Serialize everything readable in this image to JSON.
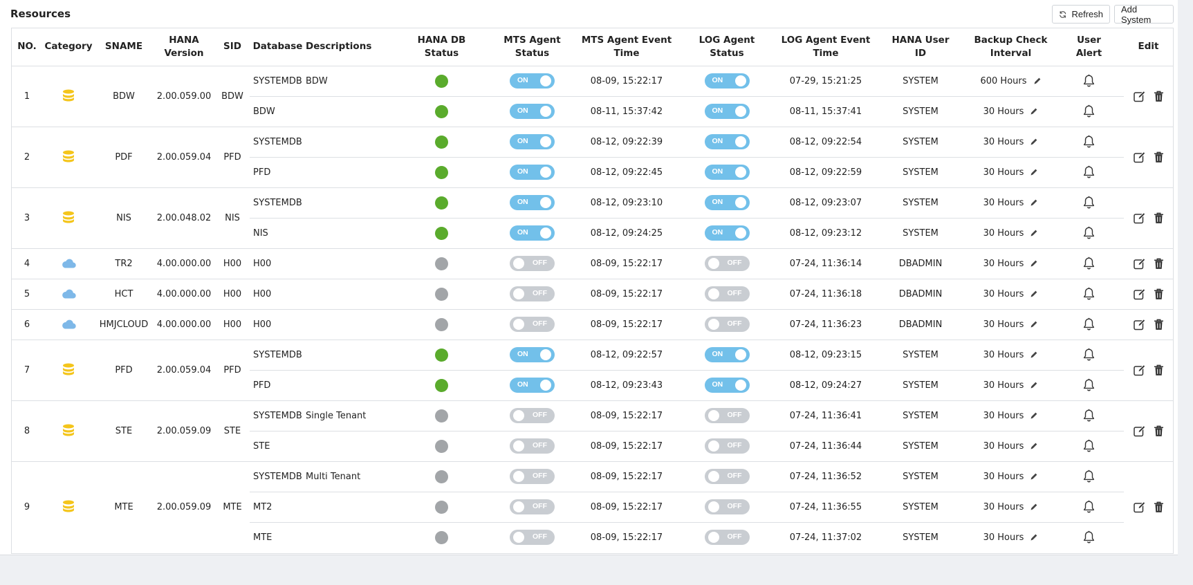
{
  "page": {
    "title": "Resources"
  },
  "toolbar": {
    "refresh_label": "Refresh",
    "add_label": "Add System"
  },
  "columns": {
    "no": "NO.",
    "category": "Category",
    "sname": "SNAME",
    "hana_version_1": "HANA",
    "hana_version_2": "Version",
    "sid": "SID",
    "database": "Database",
    "descriptions": "Descriptions",
    "db_status_1": "HANA DB",
    "db_status_2": "Status",
    "mts_status_1": "MTS Agent",
    "mts_status_2": "Status",
    "mts_time_1": "MTS Agent Event",
    "mts_time_2": "Time",
    "log_status_1": "LOG Agent",
    "log_status_2": "Status",
    "log_time_1": "LOG Agent Event",
    "log_time_2": "Time",
    "user_1": "HANA User",
    "user_2": "ID",
    "backup_1": "Backup Check",
    "backup_2": "Interval",
    "alert_1": "User",
    "alert_2": "Alert",
    "edit": "Edit"
  },
  "toggle_labels": {
    "on": "ON",
    "off": "OFF"
  },
  "colors": {
    "status_on": "#5aab2c",
    "status_off": "#a2a5a8",
    "toggle_on": "#72c0ea",
    "toggle_off": "#c9cdd2",
    "db_icon": "#f4c51b",
    "cloud_icon": "#7eb8e8"
  },
  "systems": [
    {
      "no": "1",
      "category": "database-icon",
      "sname": "BDW",
      "version": "2.00.059.00",
      "sid": "BDW",
      "dbs": [
        {
          "database": "SYSTEMDB",
          "description": "BDW",
          "db_status": "on",
          "mts": "on",
          "mts_time": "08-09, 15:22:17",
          "log": "on",
          "log_time": "07-29, 15:21:25",
          "user": "SYSTEM",
          "interval": "600 Hours"
        },
        {
          "database": "BDW",
          "description": "",
          "db_status": "on",
          "mts": "on",
          "mts_time": "08-11, 15:37:42",
          "log": "on",
          "log_time": "08-11, 15:37:41",
          "user": "SYSTEM",
          "interval": "30 Hours"
        }
      ]
    },
    {
      "no": "2",
      "category": "database-icon",
      "sname": "PDF",
      "version": "2.00.059.04",
      "sid": "PFD",
      "dbs": [
        {
          "database": "SYSTEMDB",
          "description": "",
          "db_status": "on",
          "mts": "on",
          "mts_time": "08-12, 09:22:39",
          "log": "on",
          "log_time": "08-12, 09:22:54",
          "user": "SYSTEM",
          "interval": "30 Hours"
        },
        {
          "database": "PFD",
          "description": "",
          "db_status": "on",
          "mts": "on",
          "mts_time": "08-12, 09:22:45",
          "log": "on",
          "log_time": "08-12, 09:22:59",
          "user": "SYSTEM",
          "interval": "30 Hours"
        }
      ]
    },
    {
      "no": "3",
      "category": "database-icon",
      "sname": "NIS",
      "version": "2.00.048.02",
      "sid": "NIS",
      "dbs": [
        {
          "database": "SYSTEMDB",
          "description": "",
          "db_status": "on",
          "mts": "on",
          "mts_time": "08-12, 09:23:10",
          "log": "on",
          "log_time": "08-12, 09:23:07",
          "user": "SYSTEM",
          "interval": "30 Hours"
        },
        {
          "database": "NIS",
          "description": "",
          "db_status": "on",
          "mts": "on",
          "mts_time": "08-12, 09:24:25",
          "log": "on",
          "log_time": "08-12, 09:23:12",
          "user": "SYSTEM",
          "interval": "30 Hours"
        }
      ]
    },
    {
      "no": "4",
      "category": "cloud-icon",
      "sname": "TR2",
      "version": "4.00.000.00",
      "sid": "H00",
      "dbs": [
        {
          "database": "H00",
          "description": "",
          "db_status": "off",
          "mts": "off",
          "mts_time": "08-09, 15:22:17",
          "log": "off",
          "log_time": "07-24, 11:36:14",
          "user": "DBADMIN",
          "interval": "30 Hours"
        }
      ]
    },
    {
      "no": "5",
      "category": "cloud-icon",
      "sname": "HCT",
      "version": "4.00.000.00",
      "sid": "H00",
      "dbs": [
        {
          "database": "H00",
          "description": "",
          "db_status": "off",
          "mts": "off",
          "mts_time": "08-09, 15:22:17",
          "log": "off",
          "log_time": "07-24, 11:36:18",
          "user": "DBADMIN",
          "interval": "30 Hours"
        }
      ]
    },
    {
      "no": "6",
      "category": "cloud-icon",
      "sname": "HMJCLOUD",
      "version": "4.00.000.00",
      "sid": "H00",
      "dbs": [
        {
          "database": "H00",
          "description": "",
          "db_status": "off",
          "mts": "off",
          "mts_time": "08-09, 15:22:17",
          "log": "off",
          "log_time": "07-24, 11:36:23",
          "user": "DBADMIN",
          "interval": "30 Hours"
        }
      ]
    },
    {
      "no": "7",
      "category": "database-icon",
      "sname": "PFD",
      "version": "2.00.059.04",
      "sid": "PFD",
      "dbs": [
        {
          "database": "SYSTEMDB",
          "description": "",
          "db_status": "on",
          "mts": "on",
          "mts_time": "08-12, 09:22:57",
          "log": "on",
          "log_time": "08-12, 09:23:15",
          "user": "SYSTEM",
          "interval": "30 Hours"
        },
        {
          "database": "PFD",
          "description": "",
          "db_status": "on",
          "mts": "on",
          "mts_time": "08-12, 09:23:43",
          "log": "on",
          "log_time": "08-12, 09:24:27",
          "user": "SYSTEM",
          "interval": "30 Hours"
        }
      ]
    },
    {
      "no": "8",
      "category": "database-icon",
      "sname": "STE",
      "version": "2.00.059.09",
      "sid": "STE",
      "dbs": [
        {
          "database": "SYSTEMDB",
          "description": "Single Tenant",
          "db_status": "off",
          "mts": "off",
          "mts_time": "08-09, 15:22:17",
          "log": "off",
          "log_time": "07-24, 11:36:41",
          "user": "SYSTEM",
          "interval": "30 Hours"
        },
        {
          "database": "STE",
          "description": "",
          "db_status": "off",
          "mts": "off",
          "mts_time": "08-09, 15:22:17",
          "log": "off",
          "log_time": "07-24, 11:36:44",
          "user": "SYSTEM",
          "interval": "30 Hours"
        }
      ]
    },
    {
      "no": "9",
      "category": "database-icon",
      "sname": "MTE",
      "version": "2.00.059.09",
      "sid": "MTE",
      "dbs": [
        {
          "database": "SYSTEMDB",
          "description": "Multi Tenant",
          "db_status": "off",
          "mts": "off",
          "mts_time": "08-09, 15:22:17",
          "log": "off",
          "log_time": "07-24, 11:36:52",
          "user": "SYSTEM",
          "interval": "30 Hours"
        },
        {
          "database": "MT2",
          "description": "",
          "db_status": "off",
          "mts": "off",
          "mts_time": "08-09, 15:22:17",
          "log": "off",
          "log_time": "07-24, 11:36:55",
          "user": "SYSTEM",
          "interval": "30 Hours"
        },
        {
          "database": "MTE",
          "description": "",
          "db_status": "off",
          "mts": "off",
          "mts_time": "08-09, 15:22:17",
          "log": "off",
          "log_time": "07-24, 11:37:02",
          "user": "SYSTEM",
          "interval": "30 Hours"
        }
      ]
    }
  ]
}
